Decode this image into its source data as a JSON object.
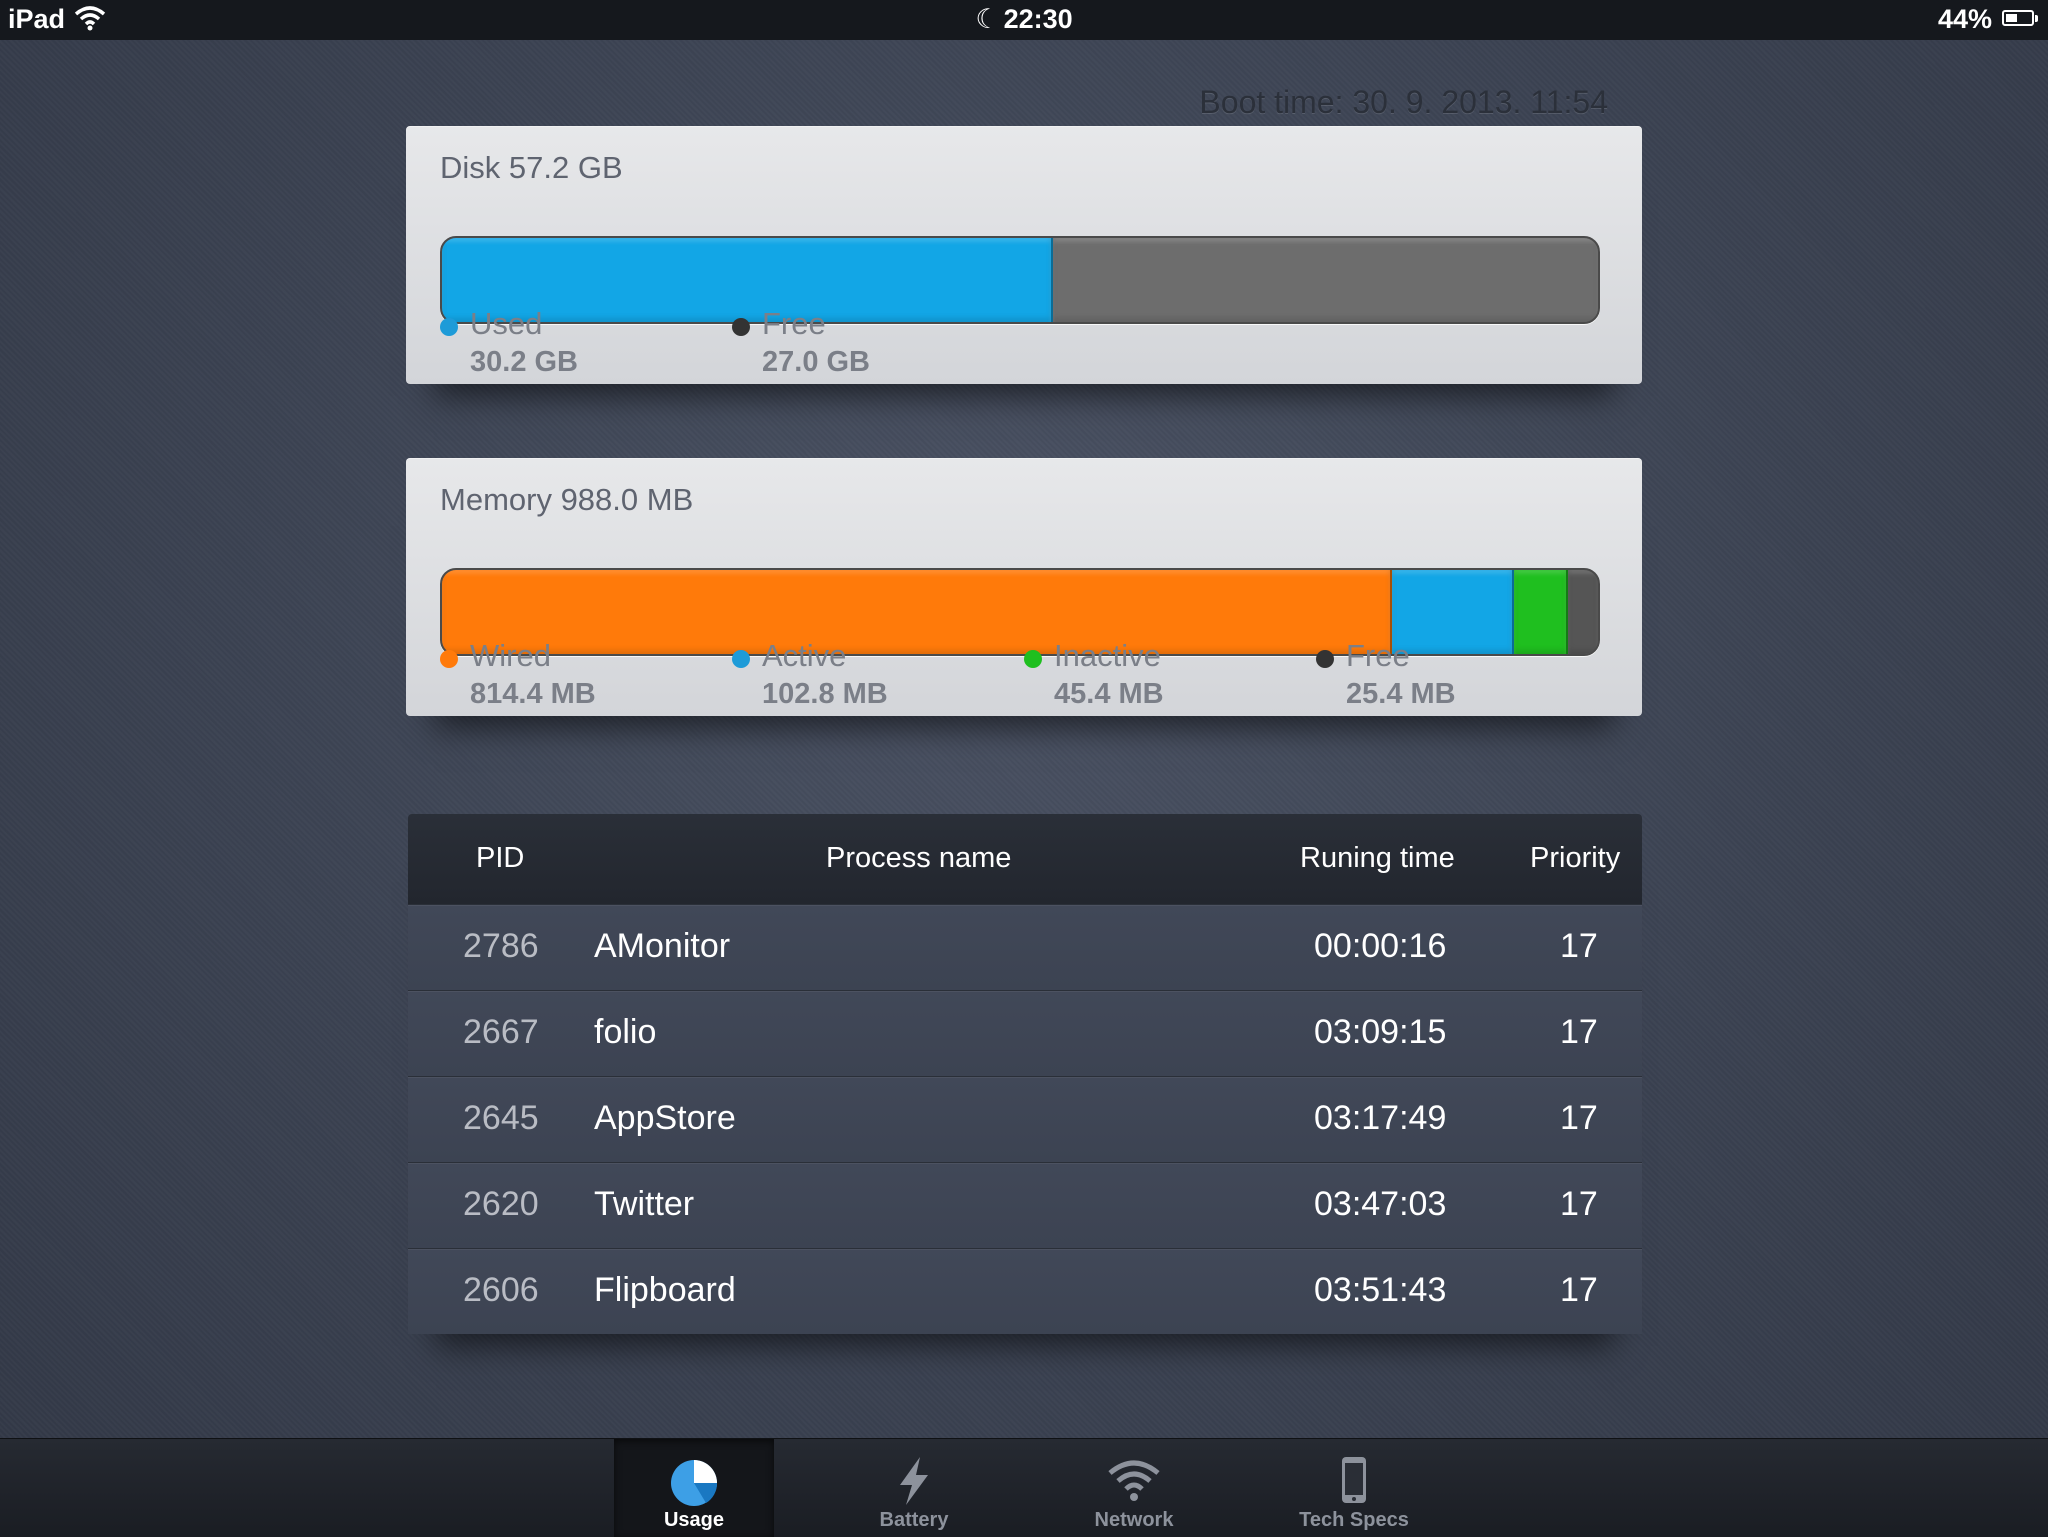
{
  "status_bar": {
    "carrier": "iPad",
    "time": "22:30",
    "battery_percent": "44%",
    "battery_level": 0.44
  },
  "boot_time": "Boot time: 30. 9. 2013. 11:54",
  "disk": {
    "title": "Disk 57.2 GB",
    "segments": [
      {
        "label": "Used",
        "value": "30.2 GB",
        "fraction": 0.528,
        "color": "#12a6e6"
      },
      {
        "label": "Free",
        "value": "27.0 GB",
        "fraction": 0.472,
        "color": "#6d6d6d"
      }
    ],
    "legend_dot_colors": [
      "#1e9bd8",
      "#333333"
    ]
  },
  "memory": {
    "title": "Memory 988.0 MB",
    "segments": [
      {
        "label": "Wired",
        "value": "814.4 MB",
        "fraction": 0.8243,
        "color": "#ff7a0a"
      },
      {
        "label": "Active",
        "value": "102.8 MB",
        "fraction": 0.104,
        "color": "#12a6e6"
      },
      {
        "label": "Inactive",
        "value": "45.4 MB",
        "fraction": 0.046,
        "color": "#1fbf1f"
      },
      {
        "label": "Free",
        "value": "25.4 MB",
        "fraction": 0.0257,
        "color": "#555555"
      }
    ],
    "legend_dot_colors": [
      "#ff7a0a",
      "#1e9bd8",
      "#1fbf1f",
      "#333333"
    ]
  },
  "process_table": {
    "headers": {
      "pid": "PID",
      "name": "Process name",
      "time": "Runing time",
      "priority": "Priority"
    },
    "rows": [
      {
        "pid": "2786",
        "name": "AMonitor",
        "time": "00:00:16",
        "priority": "17"
      },
      {
        "pid": "2667",
        "name": "folio",
        "time": "03:09:15",
        "priority": "17"
      },
      {
        "pid": "2645",
        "name": "AppStore",
        "time": "03:17:49",
        "priority": "17"
      },
      {
        "pid": "2620",
        "name": "Twitter",
        "time": "03:47:03",
        "priority": "17"
      },
      {
        "pid": "2606",
        "name": "Flipboard",
        "time": "03:51:43",
        "priority": "17"
      }
    ]
  },
  "tab_bar": {
    "active": "Usage",
    "tabs": [
      {
        "label": "Usage",
        "icon": "pie-chart-icon"
      },
      {
        "label": "Battery",
        "icon": "lightning-icon"
      },
      {
        "label": "Network",
        "icon": "wifi-icon"
      },
      {
        "label": "Tech Specs",
        "icon": "phone-icon"
      }
    ]
  }
}
